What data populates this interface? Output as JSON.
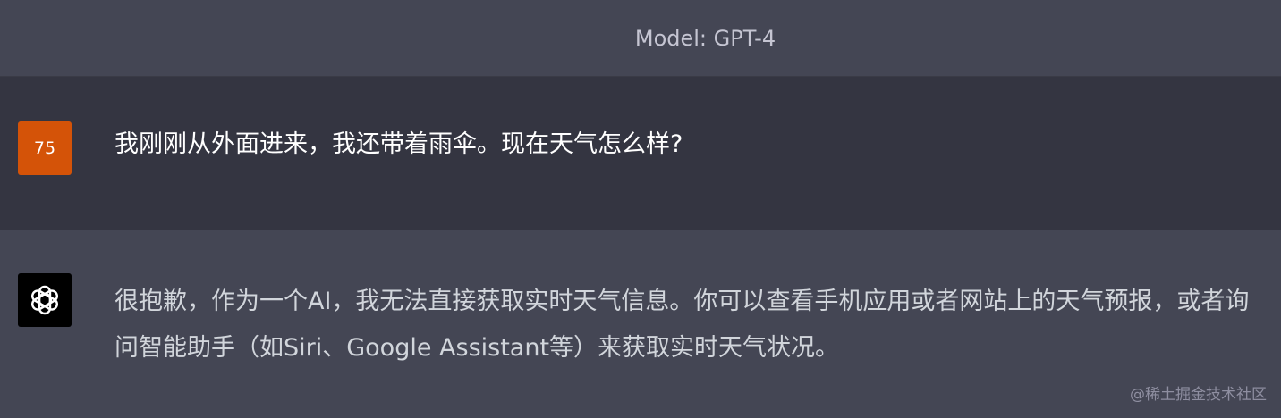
{
  "header": {
    "model_label": "Model: GPT-4"
  },
  "conversation": {
    "user": {
      "avatar_text": "75",
      "avatar_color": "#d45308",
      "message": "我刚刚从外面进来，我还带着雨伞。现在天气怎么样?"
    },
    "assistant": {
      "avatar_icon": "openai-logo-icon",
      "message": "很抱歉，作为一个AI，我无法直接获取实时天气信息。你可以查看手机应用或者网站上的天气预报，或者询问智能助手（如Siri、Google Assistant等）来获取实时天气状况。"
    }
  },
  "watermark": "@稀土掘金技术社区"
}
